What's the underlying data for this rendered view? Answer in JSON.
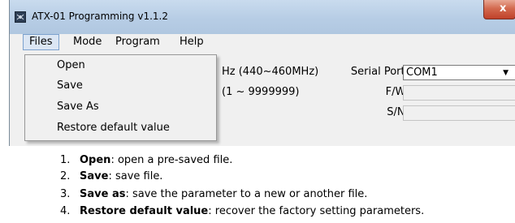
{
  "window": {
    "title": "ATX-01 Programming v1.1.2",
    "close_label": "x"
  },
  "menubar": {
    "items": [
      "Files",
      "Mode",
      "Program",
      "Help"
    ]
  },
  "main": {
    "freq_unit_text": "Hz (440~460MHz)",
    "range_text": "(1 ~ 9999999)",
    "serial_port_label": "Serial Port:",
    "serial_port_value": "COM1",
    "fw_label": "F/W:",
    "fw_value": "",
    "sn_label": "S/N:",
    "sn_value": ""
  },
  "files_menu": {
    "items": [
      "Open",
      "Save",
      "Save As",
      "Restore default value"
    ]
  },
  "instructions": [
    {
      "num": "1.",
      "term": "Open",
      "desc": ": open a pre-saved file."
    },
    {
      "num": "2.",
      "term": "Save",
      "desc": ": save file."
    },
    {
      "num": "3.",
      "term": "Save as",
      "desc": ": save the parameter to a new or another file."
    },
    {
      "num": "4.",
      "term": "Restore default value",
      "desc": ": recover the factory setting parameters."
    }
  ]
}
